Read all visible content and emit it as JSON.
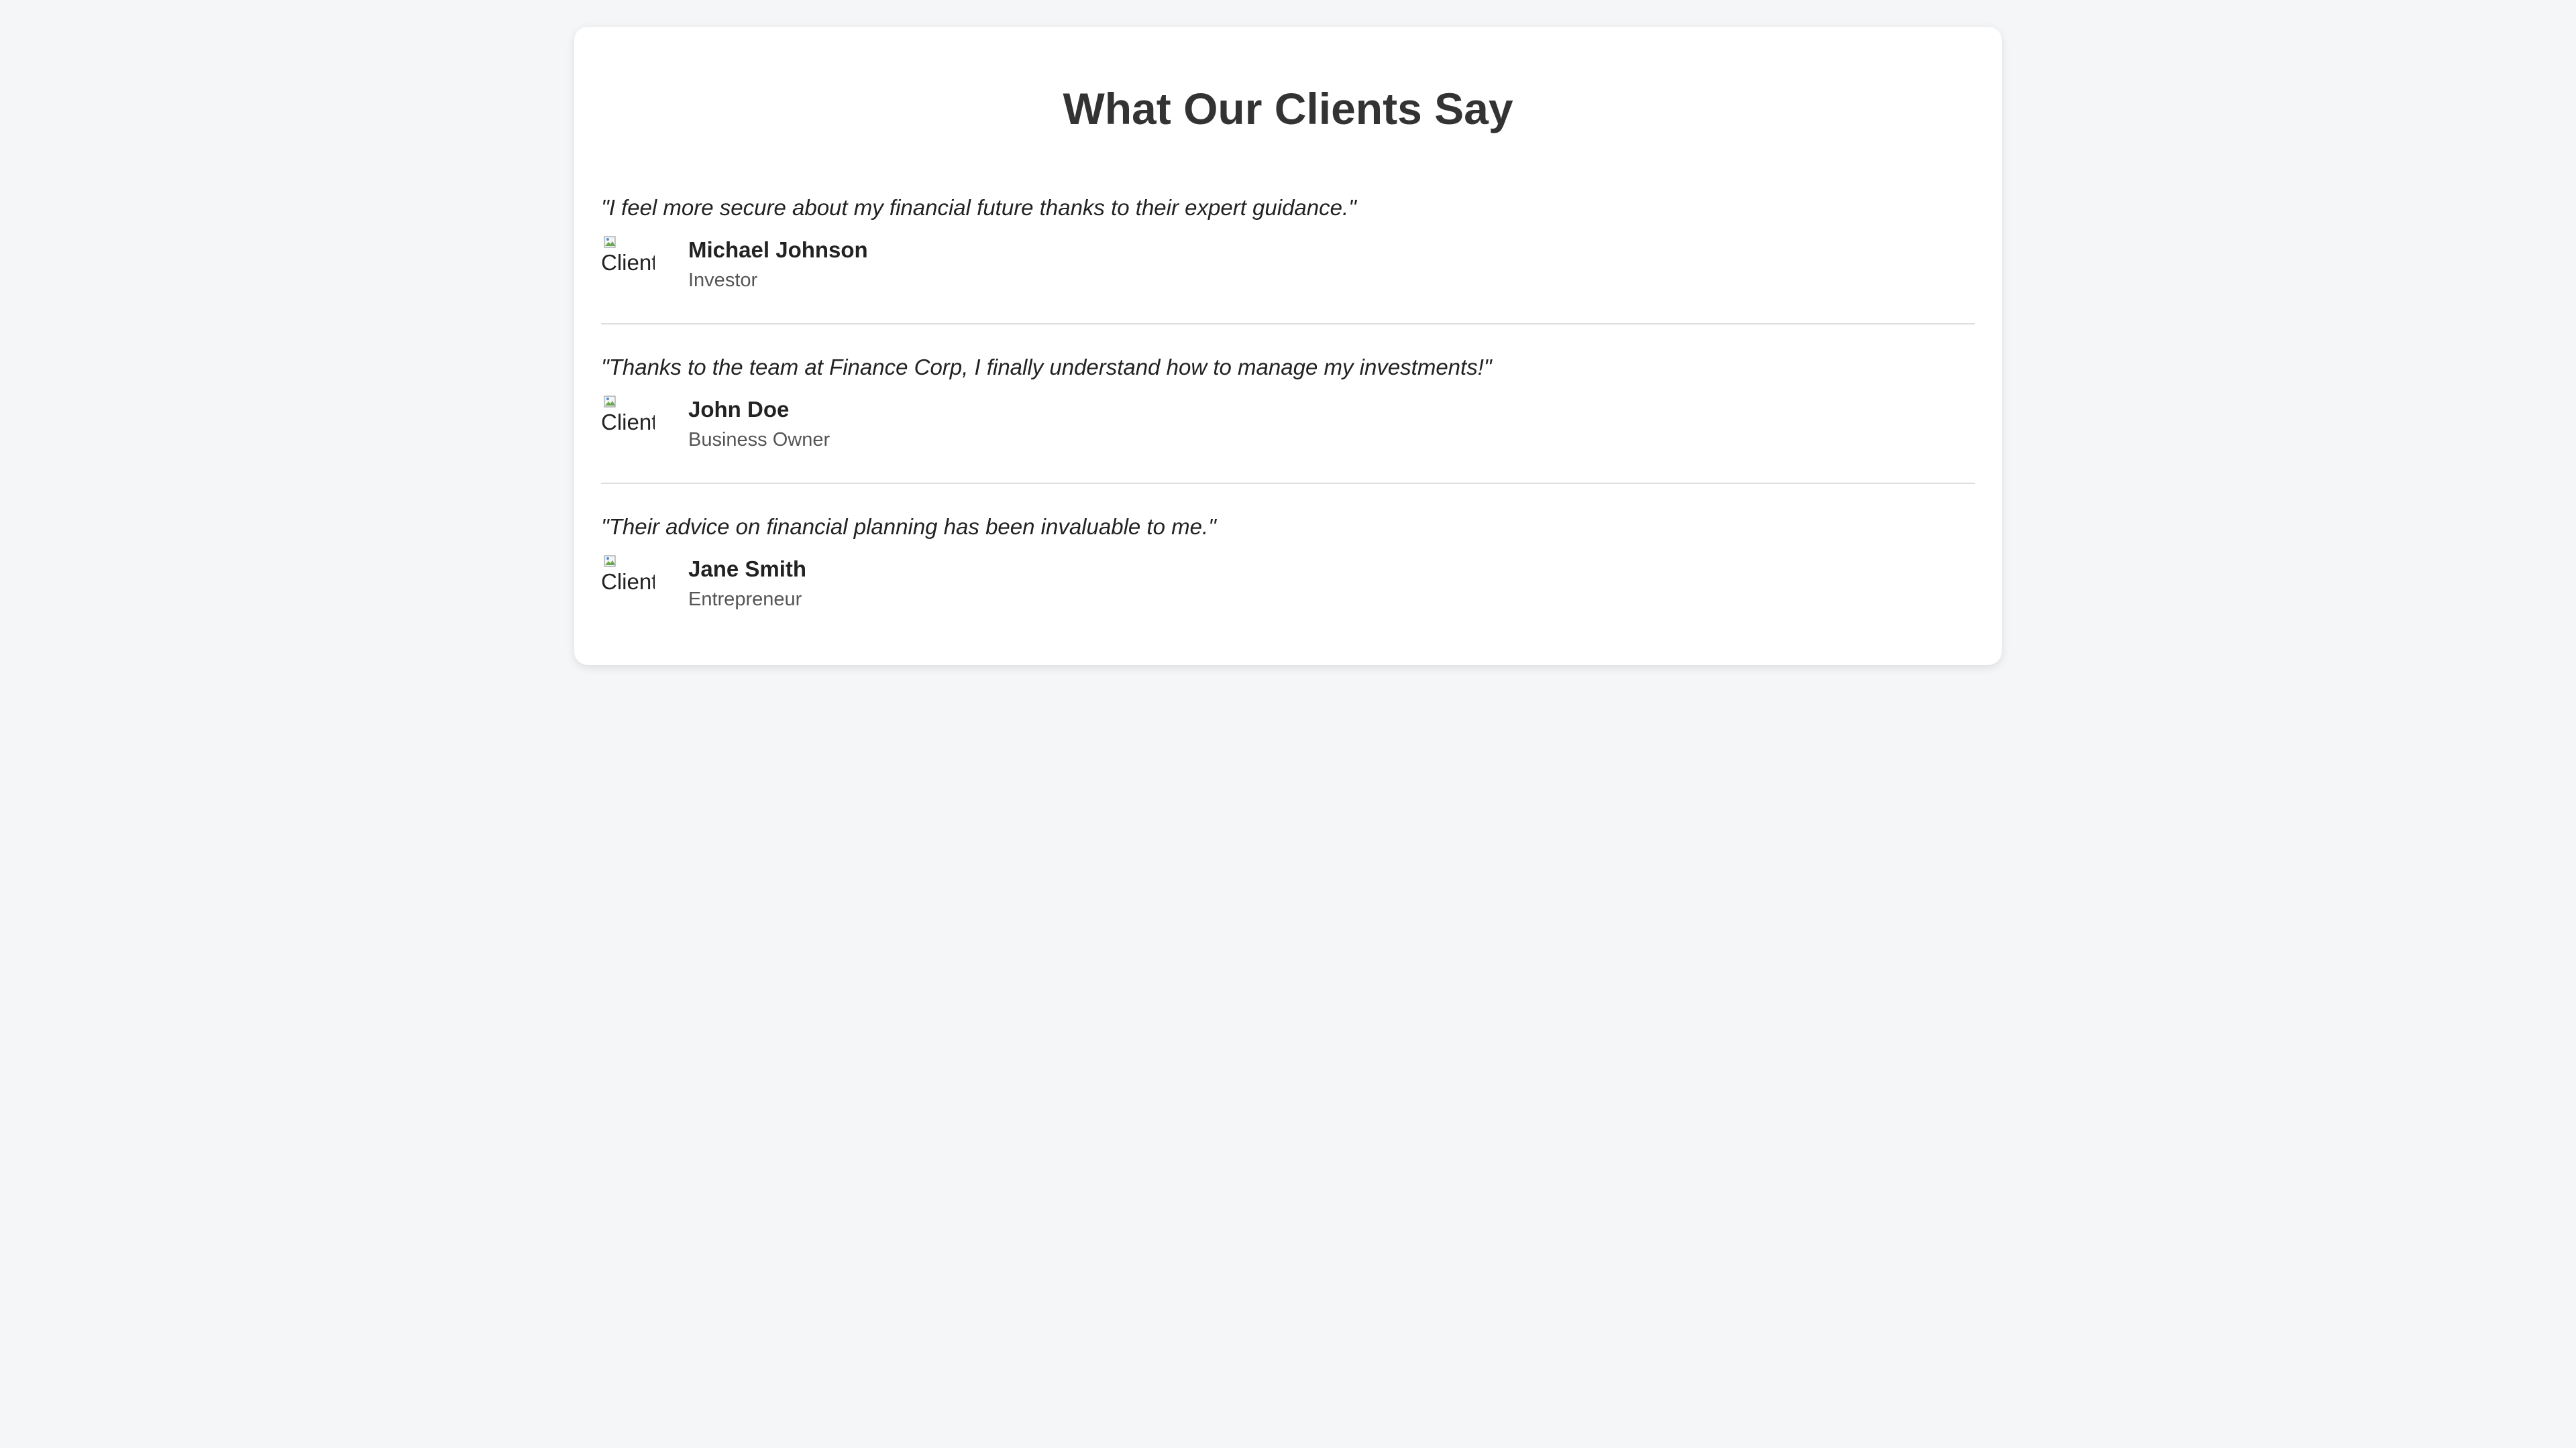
{
  "page": {
    "title": "What Our Clients Say"
  },
  "colors": {
    "background": "#f5f6f8",
    "card": "#ffffff",
    "title": "#333333",
    "quote": "#222222",
    "role": "#555555",
    "divider": "#dddddd"
  },
  "testimonials": [
    {
      "quote": "\"I feel more secure about my financial future thanks to their expert guidance.\"",
      "name": "Michael Johnson",
      "role": "Investor",
      "avatar_alt": "Client's photo",
      "avatar_icon": "broken-image-icon"
    },
    {
      "quote": "\"Thanks to the team at Finance Corp, I finally understand how to manage my investments!\"",
      "name": "John Doe",
      "role": "Business Owner",
      "avatar_alt": "Client's photo",
      "avatar_icon": "broken-image-icon"
    },
    {
      "quote": "\"Their advice on financial planning has been invaluable to me.\"",
      "name": "Jane Smith",
      "role": "Entrepreneur",
      "avatar_alt": "Client's photo",
      "avatar_icon": "broken-image-icon"
    }
  ]
}
